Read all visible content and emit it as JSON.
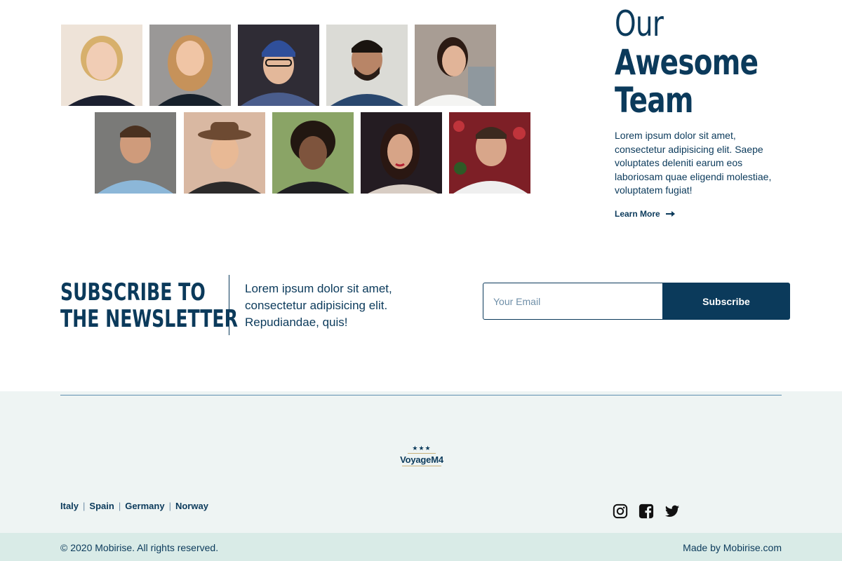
{
  "team": {
    "title_line1": "Our",
    "title_line2": "Awesome",
    "title_line3": "Team",
    "description": "Lorem ipsum dolor sit amet, consectetur adipisicing elit. Saepe voluptates deleniti earum eos laboriosam quae eligendi molestiae, voluptatem fugiat!",
    "learn_more_label": "Learn More"
  },
  "newsletter": {
    "title": "SUBSCRIBE TO\nTHE NEWSLETTER",
    "description": "Lorem ipsum dolor sit amet, consectetur adipisicing elit. Repudiandae, quis!",
    "email_placeholder": "Your Email",
    "subscribe_label": "Subscribe"
  },
  "footer": {
    "logo_stars": "★★★",
    "logo_name": "VoyageM4",
    "countries": [
      "Italy",
      "Spain",
      "Germany",
      "Norway"
    ],
    "copyright": "© 2020 Mobirise. All rights reserved.",
    "made_by": "Made by Mobirise.com"
  },
  "colors": {
    "primary": "#0b3a5b",
    "footer_bg": "#eef4f3",
    "bottom_bar_bg": "#d9ebe7"
  }
}
